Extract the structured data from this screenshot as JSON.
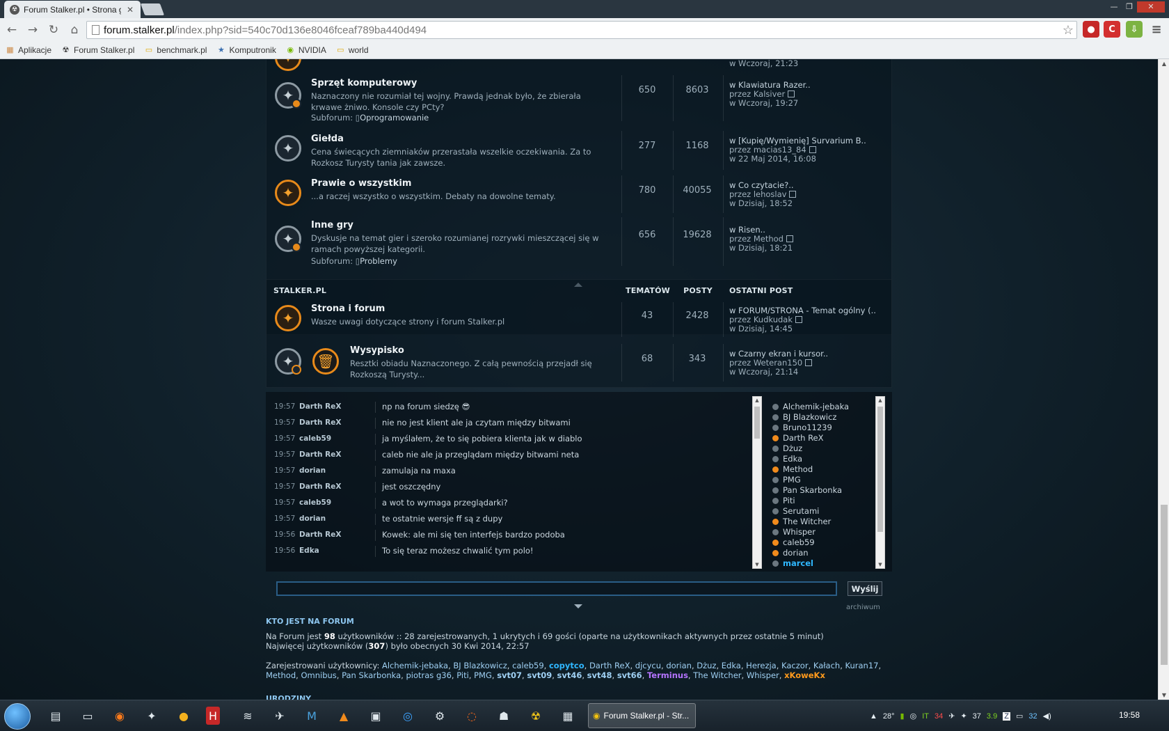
{
  "browser": {
    "tab_title": "Forum Stalker.pl • Strona g",
    "url_host": "forum.stalker.pl",
    "url_path": "/index.php?sid=540c70d136e8046fceaf789ba440d494",
    "bookmarks": [
      {
        "label": "Aplikacje",
        "icon": "apps-grid-icon"
      },
      {
        "label": "Forum Stalker.pl",
        "icon": "radiation-icon"
      },
      {
        "label": "benchmark.pl",
        "icon": "folder-icon"
      },
      {
        "label": "Komputronik",
        "icon": "star-icon"
      },
      {
        "label": "NVIDIA",
        "icon": "nvidia-icon"
      },
      {
        "label": "world",
        "icon": "folder-icon"
      }
    ]
  },
  "forums_top": [
    {
      "title": "Sprzęt komputerowy",
      "desc": "Naznaczony nie rozumiał tej wojny. Prawdą jednak było, że zbierała krwawe żniwo. Konsole czy PCty?",
      "sub_label": "Subforum:",
      "sub_link": "Oprogramowanie",
      "topics": "650",
      "posts": "8603",
      "last_topic": "w Klawiatura Razer..",
      "last_by": "przez Kalsiver",
      "last_time": "w Wczoraj, 19:27",
      "status": "new-sub"
    },
    {
      "title": "Giełda",
      "desc": "Cena świecących ziemniaków przerastała wszelkie oczekiwania. Za to Rozkosz Turysty tania jak zawsze.",
      "topics": "277",
      "posts": "1168",
      "last_topic": "w [Kupię/Wymienię] Survarium B..",
      "last_by": "przez macias13_84",
      "last_time": "w 22 Maj 2014, 16:08",
      "status": "read"
    },
    {
      "title": "Prawie o wszystkim",
      "desc": "...a raczej wszystko o wszystkim. Debaty na dowolne tematy.",
      "topics": "780",
      "posts": "40055",
      "last_topic": "w Co czytacie?..",
      "last_by": "przez lehoslav",
      "last_time": "w Dzisiaj, 18:52",
      "status": "new"
    },
    {
      "title": "Inne gry",
      "desc": "Dyskusje na temat gier i szeroko rozumianej rozrywki mieszczącej się w ramach powyższej kategorii.",
      "sub_label": "Subforum:",
      "sub_link": "Problemy",
      "topics": "656",
      "posts": "19628",
      "last_topic": "w Risen..",
      "last_by": "przez Method",
      "last_time": "w Dzisiaj, 18:21",
      "status": "new-sub"
    }
  ],
  "partial_row": {
    "last_time": "w Wczoraj, 21:23"
  },
  "section": {
    "name": "STALKER.PL",
    "col_topics": "TEMATÓW",
    "col_posts": "POSTY",
    "col_last": "OSTATNI POST"
  },
  "forums_bottom": [
    {
      "title": "Strona i forum",
      "desc": "Wasze uwagi dotyczące strony i forum Stalker.pl",
      "topics": "43",
      "posts": "2428",
      "last_topic": "w FORUM/STRONA - Temat ogólny (..",
      "last_by": "przez Kudkudak",
      "last_time": "w Dzisiaj, 14:45",
      "status": "new"
    },
    {
      "title": "Wysypisko",
      "desc": "Resztki obiadu Naznaczonego. Z całą pewnością przejadł się Rozkoszą Turysty...",
      "topics": "68",
      "posts": "343",
      "last_topic": "w Czarny ekran i kursor..",
      "last_by": "przez Weteran150",
      "last_time": "w Wczoraj, 21:14",
      "status": "locked"
    }
  ],
  "shoutbox": {
    "messages": [
      {
        "time": "19:57",
        "author": "Darth ReX",
        "text": "np na forum siedzę 😎"
      },
      {
        "time": "19:57",
        "author": "Darth ReX",
        "text": "nie no jest klient ale ja czytam między bitwami"
      },
      {
        "time": "19:57",
        "author": "caleb59",
        "text": "ja myślałem, że to się pobiera klienta jak w diablo"
      },
      {
        "time": "19:57",
        "author": "Darth ReX",
        "text": "caleb nie ale ja przeglądam między bitwami neta"
      },
      {
        "time": "19:57",
        "author": "dorian",
        "text": "zamulaja na maxa"
      },
      {
        "time": "19:57",
        "author": "Darth ReX",
        "text": "jest oszczędny"
      },
      {
        "time": "19:57",
        "author": "caleb59",
        "text": "a wot to wymaga przeglądarki?"
      },
      {
        "time": "19:57",
        "author": "dorian",
        "text": "te ostatnie wersje ff są z dupy"
      },
      {
        "time": "19:56",
        "author": "Darth ReX",
        "text": "Kowek: ale mi się ten interfejs bardzo podoba"
      },
      {
        "time": "19:56",
        "author": "Edka",
        "text": "To się teraz możesz chwalić tym polo!"
      }
    ],
    "users": [
      {
        "name": "Alchemik-jebaka",
        "online": false
      },
      {
        "name": "BJ Blazkowicz",
        "online": false
      },
      {
        "name": "Bruno11239",
        "online": false
      },
      {
        "name": "Darth ReX",
        "online": true
      },
      {
        "name": "Dżuz",
        "online": false
      },
      {
        "name": "Edka",
        "online": false
      },
      {
        "name": "Method",
        "online": true
      },
      {
        "name": "PMG",
        "online": false
      },
      {
        "name": "Pan Skarbonka",
        "online": false
      },
      {
        "name": "Piti",
        "online": false
      },
      {
        "name": "Serutami",
        "online": false
      },
      {
        "name": "The Witcher",
        "online": true
      },
      {
        "name": "Whisper",
        "online": false
      },
      {
        "name": "caleb59",
        "online": true
      },
      {
        "name": "dorian",
        "online": true
      },
      {
        "name": "marcel",
        "online": false,
        "me": true
      }
    ],
    "input_value": "",
    "send_label": "Wyślij",
    "archive_label": "archiwum"
  },
  "who_online": {
    "heading": "KTO JEST NA FORUM",
    "line1_pre": "Na Forum jest ",
    "line1_count": "98",
    "line1_post": " użytkowników :: 28 zarejestrowanych, 1 ukrytych i 69 gości (oparte na użytkownikach aktywnych przez ostatnie 5 minut)",
    "line2_pre": "Najwięcej użytkowników (",
    "line2_count": "307",
    "line2_post": ") było obecnych 30 Kwi 2014, 22:57",
    "reg_label": "Zarejestrowani użytkownicy: ",
    "users": [
      {
        "name": "Alchemik-jebaka",
        "style": "a"
      },
      {
        "name": "BJ Blazkowicz",
        "style": "a"
      },
      {
        "name": "caleb59",
        "style": "a"
      },
      {
        "name": "copytco",
        "style": "blue"
      },
      {
        "name": "Darth ReX",
        "style": "a"
      },
      {
        "name": "djcycu",
        "style": "a"
      },
      {
        "name": "dorian",
        "style": "a"
      },
      {
        "name": "Dżuz",
        "style": "a"
      },
      {
        "name": "Edka",
        "style": "a"
      },
      {
        "name": "Herezja",
        "style": "a"
      },
      {
        "name": "Kaczor",
        "style": "a"
      },
      {
        "name": "Kałach",
        "style": "a"
      },
      {
        "name": "Kuran17",
        "style": "a"
      },
      {
        "name": "Method",
        "style": "a"
      },
      {
        "name": "Omnibus",
        "style": "a"
      },
      {
        "name": "Pan Skarbonka",
        "style": "a"
      },
      {
        "name": "piotras g36",
        "style": "a"
      },
      {
        "name": "Piti",
        "style": "a"
      },
      {
        "name": "PMG",
        "style": "a"
      },
      {
        "name": "svt07",
        "style": "bold"
      },
      {
        "name": "svt09",
        "style": "bold"
      },
      {
        "name": "svt46",
        "style": "bold"
      },
      {
        "name": "svt48",
        "style": "bold"
      },
      {
        "name": "svt66",
        "style": "bold"
      },
      {
        "name": "Terminus",
        "style": "purple"
      },
      {
        "name": "The Witcher",
        "style": "a"
      },
      {
        "name": "Whisper",
        "style": "a"
      },
      {
        "name": "xKoweKx",
        "style": "orange"
      }
    ],
    "birthdays_heading": "URODZINY"
  },
  "taskbar": {
    "active_task": "Forum Stalker.pl - Str...",
    "tray_temp": "28°",
    "tray_vals": [
      "IT",
      "34",
      "37",
      "3.9",
      "32"
    ],
    "clock": "19:58"
  },
  "colors": {
    "accent_orange": "#e88a1a",
    "link_blue": "#9fd0f3",
    "me_blue": "#2fb7ff"
  }
}
